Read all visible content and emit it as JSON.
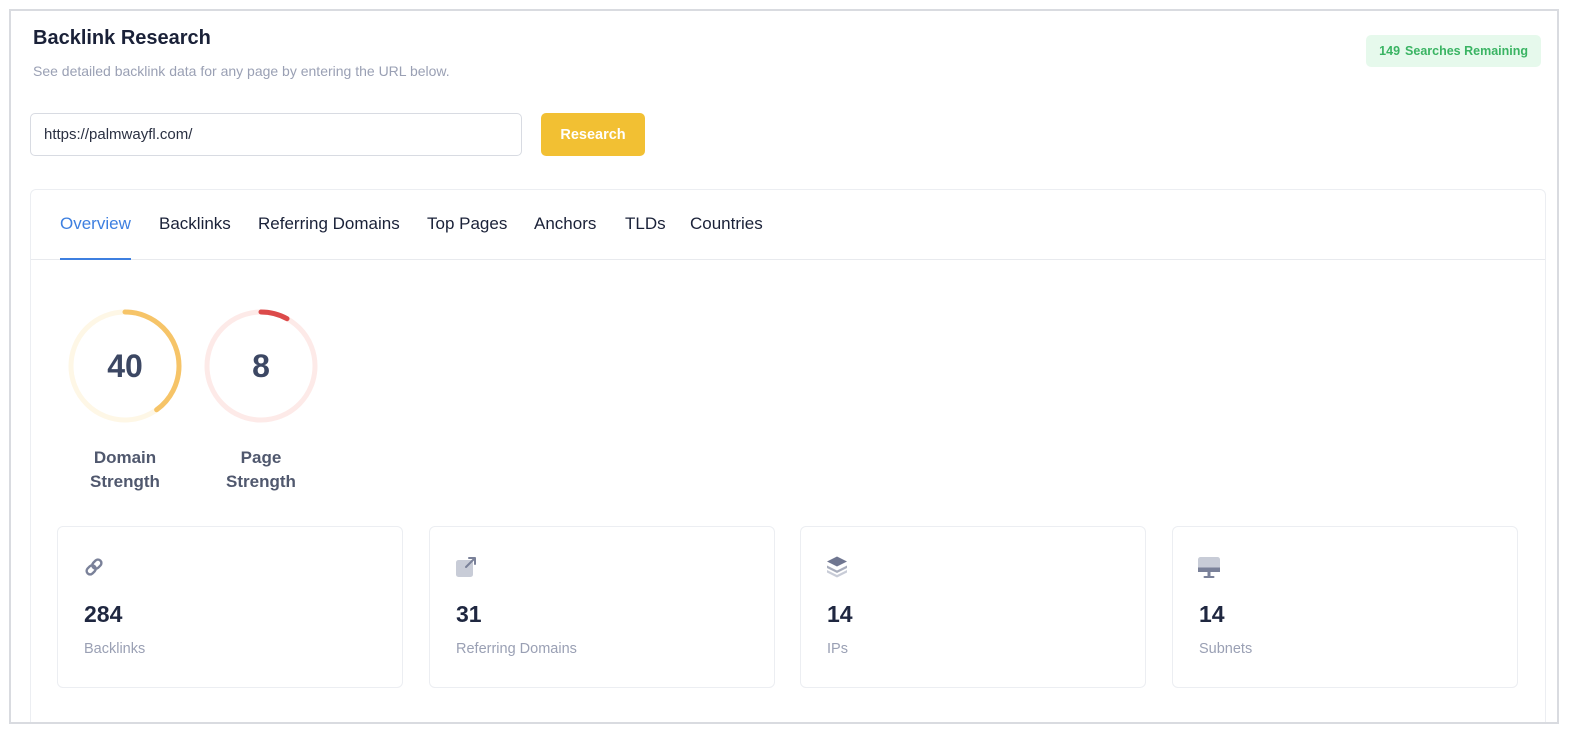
{
  "header": {
    "title": "Backlink Research",
    "subtitle": "See detailed backlink data for any page by entering the URL below.",
    "searches_count": "149",
    "searches_label": "Searches Remaining"
  },
  "search": {
    "url_value": "https://palmwayfl.com/",
    "button_label": "Research"
  },
  "tabs": [
    {
      "label": "Overview",
      "active": true
    },
    {
      "label": "Backlinks",
      "active": false
    },
    {
      "label": "Referring Domains",
      "active": false
    },
    {
      "label": "Top Pages",
      "active": false
    },
    {
      "label": "Anchors",
      "active": false
    },
    {
      "label": "TLDs",
      "active": false
    },
    {
      "label": "Countries",
      "active": false
    }
  ],
  "gauges": [
    {
      "value": "40",
      "fraction": 0.4,
      "label_line1": "Domain",
      "label_line2": "Strength",
      "color": "#f6c468",
      "track_color": "#fef7e6"
    },
    {
      "value": "8",
      "fraction": 0.08,
      "label_line1": "Page",
      "label_line2": "Strength",
      "color": "#dc4a4a",
      "track_color": "#fdeae8"
    }
  ],
  "stats": [
    {
      "value": "284",
      "label": "Backlinks",
      "icon": "link-icon"
    },
    {
      "value": "31",
      "label": "Referring Domains",
      "icon": "external-link-icon"
    },
    {
      "value": "14",
      "label": "IPs",
      "icon": "layers-icon"
    },
    {
      "value": "14",
      "label": "Subnets",
      "icon": "monitor-icon"
    }
  ],
  "colors": {
    "accent": "#3d7fe0",
    "button": "#f2c033",
    "badge_bg": "#e6f9ec",
    "badge_text": "#3ab463",
    "icon": "#7a8199"
  }
}
